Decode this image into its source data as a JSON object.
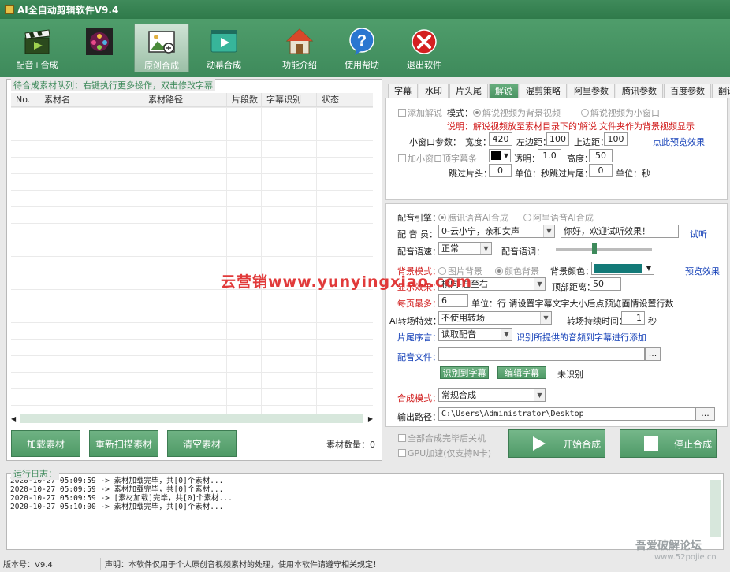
{
  "window": {
    "title": "AI全自动剪辑软件V9.4"
  },
  "toolbar": {
    "items": [
      {
        "label": "配音+合成",
        "icon": "clapper-icon"
      },
      {
        "label": "",
        "icon": "film-reel-icon"
      },
      {
        "label": "原创合成",
        "icon": "image-edit-icon",
        "active": true
      },
      {
        "label": "动幕合成",
        "icon": "play-video-icon"
      },
      {
        "label": "功能介绍",
        "icon": "home-icon"
      },
      {
        "label": "使用帮助",
        "icon": "help-icon"
      },
      {
        "label": "退出软件",
        "icon": "exit-icon"
      }
    ]
  },
  "queue": {
    "title": "待合成素材队列：右键执行更多操作，双击修改字幕",
    "columns": [
      "No.",
      "素材名",
      "素材路径",
      "片段数",
      "字幕识别",
      "状态"
    ],
    "rows": [],
    "count_label": "素材数量：",
    "count": "0",
    "buttons": {
      "load": "加载素材",
      "rescan": "重新扫描素材",
      "clear": "清空素材"
    }
  },
  "tabs": [
    "字幕",
    "水印",
    "片头尾",
    "解说",
    "混剪策略",
    "阿里参数",
    "腾讯参数",
    "百度参数",
    "翻译API"
  ],
  "active_tab": "解说",
  "narration": {
    "add_label": "添加解说",
    "mode_label": "模式：",
    "mode_bg": "解说视频为背景视频",
    "mode_small": "解说视频为小窗口",
    "note": "说明：解说视频放至素材目录下的'解说'文件夹作为背景视频显示",
    "small_params_label": "小窗口参数：",
    "width_label": "宽度：",
    "width": "420",
    "left_label": "左边距：",
    "left": "100",
    "top_label": "上边距：",
    "top": "100",
    "preview_link": "点此预览效果",
    "top_strip_label": "加小窗口顶字幕条",
    "opacity_label": "透明：",
    "opacity": "1.0",
    "height_label": "高度：",
    "height": "50",
    "skip_head_label": "跳过片头：",
    "skip_head": "0",
    "unit_sec": "单位：秒",
    "skip_tail_label": "跳过片尾：",
    "skip_tail": "0",
    "strip_color": "#000000"
  },
  "voice": {
    "engine_label": "配音引擎：",
    "engine_tencent": "腾讯语音AI合成",
    "engine_ali": "阿里语音AI合成",
    "voicer_label": "配 音 员：",
    "voicer": "0-云小宁，亲和女声",
    "sample_text": "你好，欢迎试听效果！",
    "listen_link": "试听",
    "speed_label": "配音语速：",
    "speed": "正常",
    "tone_label": "配音语调：",
    "bg_mode_label": "背景模式：",
    "bg_image": "图片背景",
    "bg_color": "颜色背景",
    "bg_color_label": "背景颜色：",
    "bg_color_value": "#137a78",
    "preview_link": "预览效果",
    "display_label": "显示效果：",
    "display": "横向-左至右",
    "top_dist_label": "顶部距离：",
    "top_dist": "50",
    "perpage_label": "每页最多：",
    "perpage": "6",
    "perpage_note": "单位：行 请设置字幕文字大小后点预览面情设置行数",
    "transition_label": "AI转场特效：",
    "transition": "不使用转场",
    "transition_time_label": "转场持续时间：",
    "transition_time": "1",
    "transition_unit": "秒",
    "order_label": "片尾序言：",
    "order": "读取配音",
    "order_note": "识别所提供的音频到字幕进行添加",
    "file_label": "配音文件：",
    "file": "",
    "recognize_btn": "识别到字幕",
    "edit_btn": "编辑字幕",
    "recognize_status": "未识别",
    "synth_mode_label": "合成模式：",
    "synth_mode": "常规合成",
    "output_label": "输出路径：",
    "output": "C:\\Users\\Administrator\\Desktop",
    "dots": "..."
  },
  "actions": {
    "shutdown_label": "全部合成完毕后关机",
    "gpu_label": "GPU加速(仅支持N卡)",
    "start": "开始合成",
    "stop": "停止合成"
  },
  "log": {
    "title": "运行日志：",
    "lines": [
      "2020-10-27 05:09:59 -> 素材加载完毕，共[0]个素材...",
      "2020-10-27 05:09:59 -> 素材加载完毕，共[0]个素材...",
      "2020-10-27 05:09:59 -> [素材加载]完毕，共[0]个素材...",
      "2020-10-27 05:10:00 -> 素材加载完毕，共[0]个素材..."
    ]
  },
  "status": {
    "version": "版本号：V9.4",
    "notice": "声明：本软件仅用于个人原创音视频素材的处理，使用本软件请遵守相关规定！"
  },
  "watermarks": {
    "center": "云营销www.yunyingxiao.com",
    "corner": "吾爱破解论坛",
    "corner_url": "www.52pojie.cn"
  }
}
